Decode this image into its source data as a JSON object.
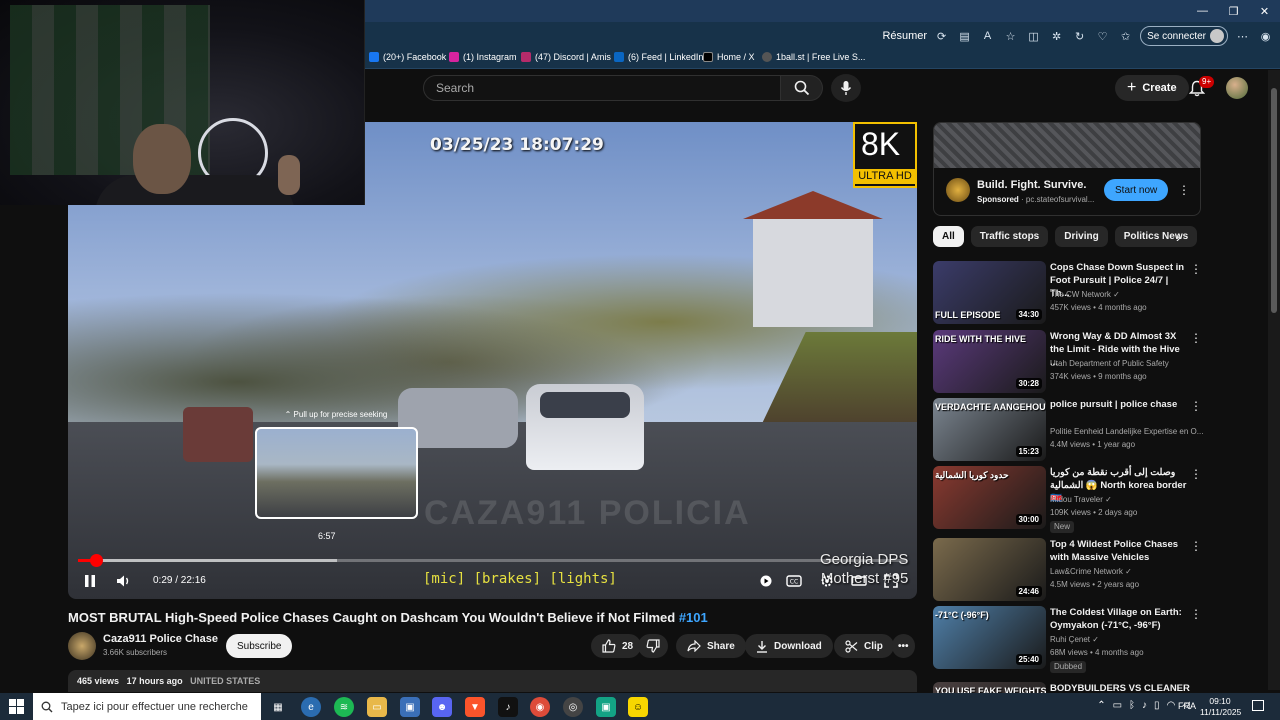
{
  "browser": {
    "resume_label": "Résumer",
    "signin_label": "Se connecter",
    "window_controls": [
      "—",
      "❐",
      "✕"
    ],
    "bookmarks": [
      {
        "label": "(20+) Facebook",
        "color": "#1877f2",
        "glyph": "f"
      },
      {
        "label": "(1) Instagram",
        "color": "#d6249f",
        "glyph": "◎"
      },
      {
        "label": "(47) Discord | Amis",
        "color": "#b52b6a",
        "glyph": "☻"
      },
      {
        "label": "(6) Feed | LinkedIn",
        "color": "#0a66c2",
        "glyph": "in"
      },
      {
        "label": "Home / X",
        "color": "#000000",
        "glyph": "X"
      },
      {
        "label": "1ball.st | Free Live S...",
        "color": "#555555",
        "glyph": "⊕"
      }
    ]
  },
  "header": {
    "search_placeholder": "Search",
    "create_label": "Create",
    "notification_count": "9+"
  },
  "player": {
    "timestamp_overlay": "03/25/23 18:07:29",
    "badge_8k": "8K",
    "badge_ultra": "ULTRA HD",
    "pull_hint": "⌃ Pull up for precise seeking",
    "seek_preview_time": "6:57",
    "overlay_line1": "Georgia DPS",
    "overlay_line2": "Motherst #95",
    "watermark": "CAZA911 POLICIA",
    "captions": "[mic] [brakes] [lights]",
    "time_display": "0:29 / 22:16",
    "played_fraction": 0.022,
    "hover_fraction": 0.312
  },
  "video": {
    "title": "MOST BRUTAL High-Speed Police Chases Caught on Dashcam You Wouldn't Believe if Not Filmed",
    "hashtag": "#101",
    "channel": "Caza911 Police Chase",
    "subscribers": "3.66K subscribers",
    "subscribe_label": "Subscribe",
    "likes": "28",
    "share_label": "Share",
    "download_label": "Download",
    "clip_label": "Clip",
    "views": "465 views",
    "age": "17 hours ago",
    "country": "UNITED STATES"
  },
  "ad": {
    "title": "Build. Fight. Survive.",
    "sponsored": "Sponsored",
    "domain": "pc.stateofsurvival...",
    "cta": "Start now"
  },
  "chips": [
    "All",
    "Traffic stops",
    "Driving",
    "Politics News"
  ],
  "recommendations": [
    {
      "title": "Cops Chase Down Suspect in Foot Pursuit | Police 24/7 | Th...",
      "channel": "The CW Network ✓",
      "meta": "457K views • 4 months ago",
      "duration": "34:30",
      "overlay": "FULL EPISODE",
      "badge": "",
      "thumb_color": "#3b3c6a"
    },
    {
      "title": "Wrong Way & DD Almost 3X the Limit - Ride with the Hive ...",
      "channel": "Utah Department of Public Safety",
      "meta": "374K views • 9 months ago",
      "duration": "30:28",
      "overlay": "RIDE WITH THE HIVE",
      "badge": "",
      "thumb_color": "#5b3a7c"
    },
    {
      "title": "police pursuit | police chase",
      "channel": "Politie Eenheid Landelijke Expertise en O...",
      "meta": "4.4M views • 1 year ago",
      "duration": "15:23",
      "overlay": "VERDACHTE AANGEHOUDEN",
      "badge": "",
      "thumb_color": "#7b8590"
    },
    {
      "title": "وصلت إلى أقرب نقطة من كوريا الشمالية 😱 North korea border 🇰🇵",
      "channel": "Midou Traveler ✓",
      "meta": "109K views • 2 days ago",
      "duration": "30:00",
      "overlay": "حدود كوريا الشمالية",
      "badge": "New",
      "thumb_color": "#8a3a30"
    },
    {
      "title": "Top 4 Wildest Police Chases with Massive Vehicles",
      "channel": "Law&Crime Network ✓",
      "meta": "4.5M views • 2 years ago",
      "duration": "24:46",
      "overlay": "",
      "badge": "",
      "thumb_color": "#7a6a4c"
    },
    {
      "title": "The Coldest Village on Earth: Oymyakon (-71°C, -96°F)",
      "channel": "Ruhi Çenet ✓",
      "meta": "68M views • 4 months ago",
      "duration": "25:40",
      "overlay": "-71°C (-96°F)",
      "badge": "Dubbed",
      "thumb_color": "#4f7fa8"
    },
    {
      "title": "BODYBUILDERS VS CLEANER |",
      "channel": "",
      "meta": "",
      "duration": "",
      "overlay": "YOU USE FAKE WEIGHTS!",
      "badge": "",
      "thumb_color": "#4a4040"
    }
  ],
  "taskbar": {
    "search_placeholder": "Tapez ici pour effectuer une recherche",
    "lang": "FRA",
    "time": "09:10",
    "date": "11/11/2025"
  }
}
